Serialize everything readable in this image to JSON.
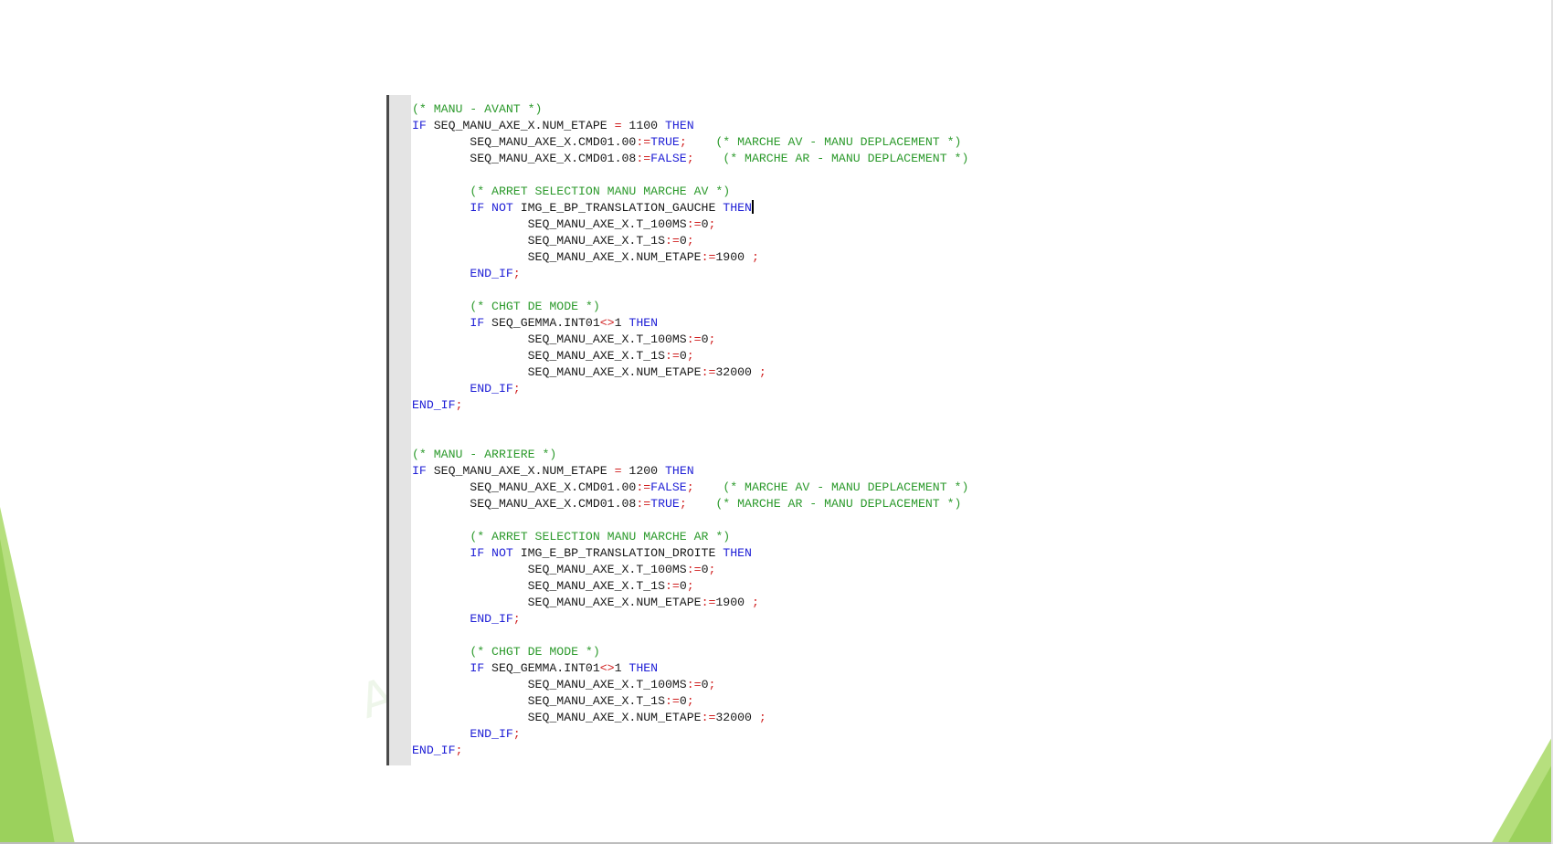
{
  "colors": {
    "keyword": "#1f1fd6",
    "comment": "#2c9a2c",
    "operator": "#d01f1f",
    "text": "#1a1a1a",
    "gutter": "#e4e4e4",
    "accent_green": "#9bd15c"
  },
  "watermark": "A",
  "code": {
    "lines": [
      [
        {
          "t": "cm",
          "v": "(* MANU - AVANT *)"
        }
      ],
      [
        {
          "t": "kw",
          "v": "IF"
        },
        {
          "t": "tx",
          "v": " SEQ_MANU_AXE_X.NUM_ETAPE "
        },
        {
          "t": "op",
          "v": "="
        },
        {
          "t": "tx",
          "v": " 1100 "
        },
        {
          "t": "kw",
          "v": "THEN"
        }
      ],
      [
        {
          "t": "tx",
          "v": "        SEQ_MANU_AXE_X.CMD01.00"
        },
        {
          "t": "op",
          "v": ":="
        },
        {
          "t": "kw",
          "v": "TRUE"
        },
        {
          "t": "op",
          "v": ";"
        },
        {
          "t": "tx",
          "v": "    "
        },
        {
          "t": "cm",
          "v": "(* MARCHE AV - MANU DEPLACEMENT *)"
        }
      ],
      [
        {
          "t": "tx",
          "v": "        SEQ_MANU_AXE_X.CMD01.08"
        },
        {
          "t": "op",
          "v": ":="
        },
        {
          "t": "kw",
          "v": "FALSE"
        },
        {
          "t": "op",
          "v": ";"
        },
        {
          "t": "tx",
          "v": "    "
        },
        {
          "t": "cm",
          "v": "(* MARCHE AR - MANU DEPLACEMENT *)"
        }
      ],
      [],
      [
        {
          "t": "tx",
          "v": "        "
        },
        {
          "t": "cm",
          "v": "(* ARRET SELECTION MANU MARCHE AV *)"
        }
      ],
      [
        {
          "t": "tx",
          "v": "        "
        },
        {
          "t": "kw",
          "v": "IF NOT"
        },
        {
          "t": "tx",
          "v": " IMG_E_BP_TRANSLATION_GAUCHE "
        },
        {
          "t": "kw",
          "v": "THEN"
        },
        {
          "t": "caret",
          "v": ""
        }
      ],
      [
        {
          "t": "tx",
          "v": "                SEQ_MANU_AXE_X.T_100MS"
        },
        {
          "t": "op",
          "v": ":="
        },
        {
          "t": "tx",
          "v": "0"
        },
        {
          "t": "op",
          "v": ";"
        }
      ],
      [
        {
          "t": "tx",
          "v": "                SEQ_MANU_AXE_X.T_1S"
        },
        {
          "t": "op",
          "v": ":="
        },
        {
          "t": "tx",
          "v": "0"
        },
        {
          "t": "op",
          "v": ";"
        }
      ],
      [
        {
          "t": "tx",
          "v": "                SEQ_MANU_AXE_X.NUM_ETAPE"
        },
        {
          "t": "op",
          "v": ":="
        },
        {
          "t": "tx",
          "v": "1900 "
        },
        {
          "t": "op",
          "v": ";"
        }
      ],
      [
        {
          "t": "tx",
          "v": "        "
        },
        {
          "t": "kw",
          "v": "END_IF"
        },
        {
          "t": "op",
          "v": ";"
        }
      ],
      [],
      [
        {
          "t": "tx",
          "v": "        "
        },
        {
          "t": "cm",
          "v": "(* CHGT DE MODE *)"
        }
      ],
      [
        {
          "t": "tx",
          "v": "        "
        },
        {
          "t": "kw",
          "v": "IF"
        },
        {
          "t": "tx",
          "v": " SEQ_GEMMA.INT01"
        },
        {
          "t": "op",
          "v": "<>"
        },
        {
          "t": "tx",
          "v": "1 "
        },
        {
          "t": "kw",
          "v": "THEN"
        }
      ],
      [
        {
          "t": "tx",
          "v": "                SEQ_MANU_AXE_X.T_100MS"
        },
        {
          "t": "op",
          "v": ":="
        },
        {
          "t": "tx",
          "v": "0"
        },
        {
          "t": "op",
          "v": ";"
        }
      ],
      [
        {
          "t": "tx",
          "v": "                SEQ_MANU_AXE_X.T_1S"
        },
        {
          "t": "op",
          "v": ":="
        },
        {
          "t": "tx",
          "v": "0"
        },
        {
          "t": "op",
          "v": ";"
        }
      ],
      [
        {
          "t": "tx",
          "v": "                SEQ_MANU_AXE_X.NUM_ETAPE"
        },
        {
          "t": "op",
          "v": ":="
        },
        {
          "t": "tx",
          "v": "32000 "
        },
        {
          "t": "op",
          "v": ";"
        }
      ],
      [
        {
          "t": "tx",
          "v": "        "
        },
        {
          "t": "kw",
          "v": "END_IF"
        },
        {
          "t": "op",
          "v": ";"
        }
      ],
      [
        {
          "t": "kw",
          "v": "END_IF"
        },
        {
          "t": "op",
          "v": ";"
        }
      ],
      [],
      [],
      [
        {
          "t": "cm",
          "v": "(* MANU - ARRIERE *)"
        }
      ],
      [
        {
          "t": "kw",
          "v": "IF"
        },
        {
          "t": "tx",
          "v": " SEQ_MANU_AXE_X.NUM_ETAPE "
        },
        {
          "t": "op",
          "v": "="
        },
        {
          "t": "tx",
          "v": " 1200 "
        },
        {
          "t": "kw",
          "v": "THEN"
        }
      ],
      [
        {
          "t": "tx",
          "v": "        SEQ_MANU_AXE_X.CMD01.00"
        },
        {
          "t": "op",
          "v": ":="
        },
        {
          "t": "kw",
          "v": "FALSE"
        },
        {
          "t": "op",
          "v": ";"
        },
        {
          "t": "tx",
          "v": "    "
        },
        {
          "t": "cm",
          "v": "(* MARCHE AV - MANU DEPLACEMENT *)"
        }
      ],
      [
        {
          "t": "tx",
          "v": "        SEQ_MANU_AXE_X.CMD01.08"
        },
        {
          "t": "op",
          "v": ":="
        },
        {
          "t": "kw",
          "v": "TRUE"
        },
        {
          "t": "op",
          "v": ";"
        },
        {
          "t": "tx",
          "v": "    "
        },
        {
          "t": "cm",
          "v": "(* MARCHE AR - MANU DEPLACEMENT *)"
        }
      ],
      [],
      [
        {
          "t": "tx",
          "v": "        "
        },
        {
          "t": "cm",
          "v": "(* ARRET SELECTION MANU MARCHE AR *)"
        }
      ],
      [
        {
          "t": "tx",
          "v": "        "
        },
        {
          "t": "kw",
          "v": "IF NOT"
        },
        {
          "t": "tx",
          "v": " IMG_E_BP_TRANSLATION_DROITE "
        },
        {
          "t": "kw",
          "v": "THEN"
        }
      ],
      [
        {
          "t": "tx",
          "v": "                SEQ_MANU_AXE_X.T_100MS"
        },
        {
          "t": "op",
          "v": ":="
        },
        {
          "t": "tx",
          "v": "0"
        },
        {
          "t": "op",
          "v": ";"
        }
      ],
      [
        {
          "t": "tx",
          "v": "                SEQ_MANU_AXE_X.T_1S"
        },
        {
          "t": "op",
          "v": ":="
        },
        {
          "t": "tx",
          "v": "0"
        },
        {
          "t": "op",
          "v": ";"
        }
      ],
      [
        {
          "t": "tx",
          "v": "                SEQ_MANU_AXE_X.NUM_ETAPE"
        },
        {
          "t": "op",
          "v": ":="
        },
        {
          "t": "tx",
          "v": "1900 "
        },
        {
          "t": "op",
          "v": ";"
        }
      ],
      [
        {
          "t": "tx",
          "v": "        "
        },
        {
          "t": "kw",
          "v": "END_IF"
        },
        {
          "t": "op",
          "v": ";"
        }
      ],
      [],
      [
        {
          "t": "tx",
          "v": "        "
        },
        {
          "t": "cm",
          "v": "(* CHGT DE MODE *)"
        }
      ],
      [
        {
          "t": "tx",
          "v": "        "
        },
        {
          "t": "kw",
          "v": "IF"
        },
        {
          "t": "tx",
          "v": " SEQ_GEMMA.INT01"
        },
        {
          "t": "op",
          "v": "<>"
        },
        {
          "t": "tx",
          "v": "1 "
        },
        {
          "t": "kw",
          "v": "THEN"
        }
      ],
      [
        {
          "t": "tx",
          "v": "                SEQ_MANU_AXE_X.T_100MS"
        },
        {
          "t": "op",
          "v": ":="
        },
        {
          "t": "tx",
          "v": "0"
        },
        {
          "t": "op",
          "v": ";"
        }
      ],
      [
        {
          "t": "tx",
          "v": "                SEQ_MANU_AXE_X.T_1S"
        },
        {
          "t": "op",
          "v": ":="
        },
        {
          "t": "tx",
          "v": "0"
        },
        {
          "t": "op",
          "v": ";"
        }
      ],
      [
        {
          "t": "tx",
          "v": "                SEQ_MANU_AXE_X.NUM_ETAPE"
        },
        {
          "t": "op",
          "v": ":="
        },
        {
          "t": "tx",
          "v": "32000 "
        },
        {
          "t": "op",
          "v": ";"
        }
      ],
      [
        {
          "t": "tx",
          "v": "        "
        },
        {
          "t": "kw",
          "v": "END_IF"
        },
        {
          "t": "op",
          "v": ";"
        }
      ],
      [
        {
          "t": "kw",
          "v": "END_IF"
        },
        {
          "t": "op",
          "v": ";"
        }
      ]
    ]
  }
}
